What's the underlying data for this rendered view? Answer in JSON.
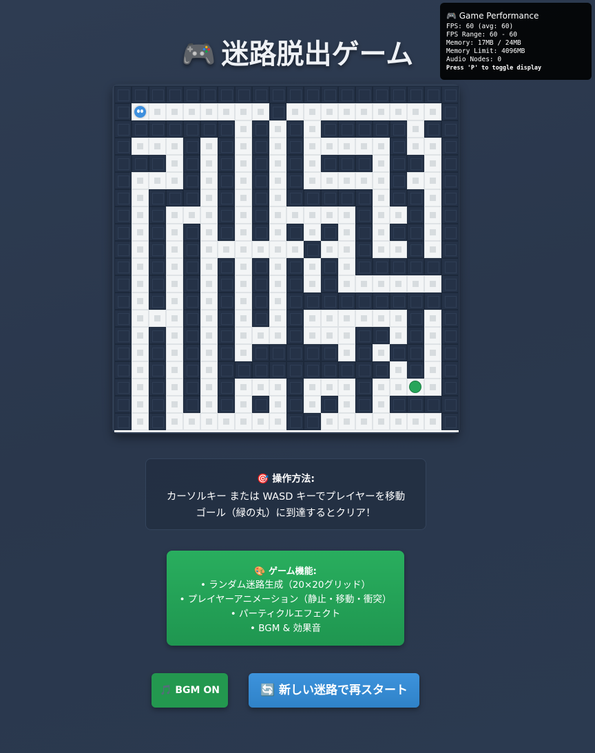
{
  "title": {
    "emoji": "🎮",
    "text": "迷路脱出ゲーム"
  },
  "performance": {
    "heading": "🎮 Game Performance",
    "lines": [
      "FPS: 60 (avg: 60)",
      "FPS Range: 60 - 60",
      "Memory: 17MB / 24MB",
      "Memory Limit: 4096MB",
      "Audio Nodes: 0"
    ],
    "hint": "Press 'P' to toggle display"
  },
  "maze": {
    "grid_size": "20x20",
    "rows": [
      "####################",
      "#P.......#.........#",
      "#######.#.#.#####.##",
      "#...#.#.#.#.....#..#",
      "###.#.#.#.#.###.##.#",
      "#...#.#.#.#.....#..#",
      "#.###.#.#.#####.##.#",
      "#.#...#.#.....#..#.#",
      "#.#.#.#.#.#.#.#.##.#",
      "#.#.#......#..#..#.#",
      "#.#.#.#.#.#.#.######",
      "#.#.#.#.#.#.#......#",
      "#.#.#.#.#.##########",
      "#...#.#.#.#......#.#",
      "#.#.#.#...#...##.#.#",
      "#.#.#.#.#####.#.##.#",
      "#.#.#.##########.#.#",
      "#.#.#.#...#...#..G.#",
      "#.#.#.#.#.#.#.#.####",
      "#.#.......##.......#"
    ],
    "player_color": "#3d8fde",
    "goal_color": "#27a55a"
  },
  "instructions": {
    "icon": "🎯",
    "heading": "操作方法:",
    "lines": [
      "カーソルキー または WASD キーでプレイヤーを移動",
      "ゴール（緑の丸）に到達するとクリア！"
    ]
  },
  "features": {
    "icon": "🎨",
    "heading": "ゲーム機能:",
    "lines": [
      "• ランダム迷路生成（20×20グリッド）",
      "• プレイヤーアニメーション（静止・移動・衝突）",
      "• パーティクルエフェクト",
      "• BGM & 効果音"
    ]
  },
  "buttons": {
    "bgm": {
      "icon": "🎵",
      "label": "BGM ON"
    },
    "restart": {
      "icon": "🔄",
      "label": "新しい迷路で再スタート"
    }
  }
}
